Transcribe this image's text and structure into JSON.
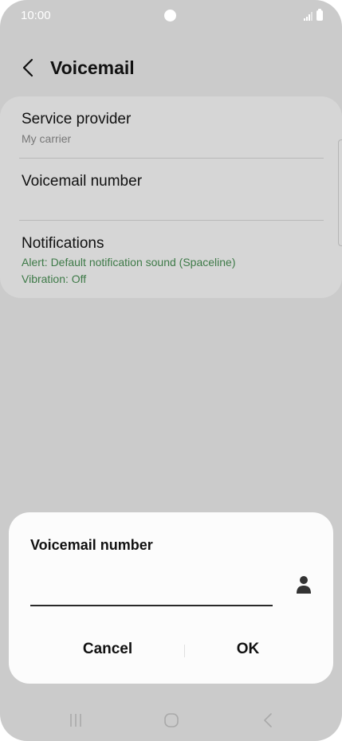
{
  "status_bar": {
    "time": "10:00"
  },
  "header": {
    "title": "Voicemail"
  },
  "settings": {
    "items": [
      {
        "title": "Service provider",
        "subtitle": "My carrier"
      },
      {
        "title": "Voicemail number"
      },
      {
        "title": "Notifications",
        "alert": "Alert: Default notification sound (Spaceline)",
        "vibration": "Vibration: Off"
      }
    ]
  },
  "dialog": {
    "title": "Voicemail number",
    "input_value": "",
    "cancel_label": "Cancel",
    "ok_label": "OK"
  },
  "colors": {
    "accent_green": "#3e7a48",
    "overlay": "#cbcbcb",
    "dialog_bg": "#fcfcfc"
  },
  "icons": [
    "back-icon",
    "contact-person-icon",
    "signal-icon",
    "battery-icon",
    "recents-icon",
    "home-icon",
    "nav-back-icon"
  ]
}
